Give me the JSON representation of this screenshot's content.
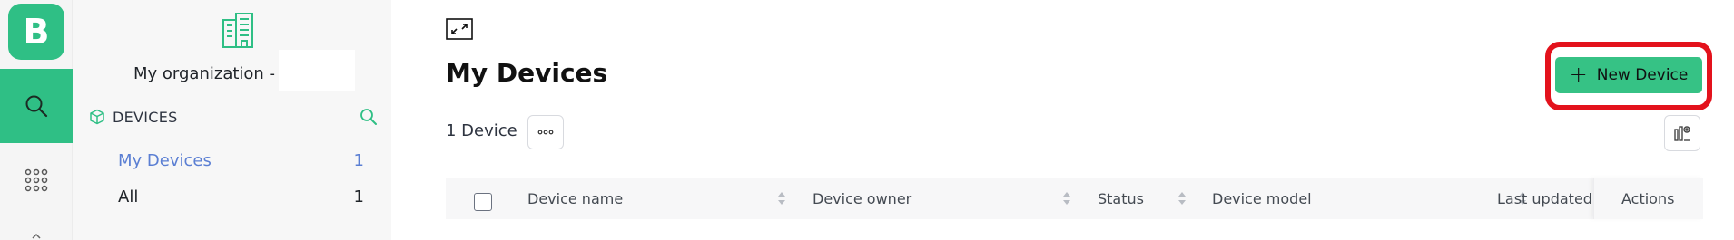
{
  "rail": {
    "logo_letter": "B",
    "icons": [
      "search-icon",
      "apps-grid-icon",
      "chevron-icon"
    ],
    "accent_color": "#2fbf85"
  },
  "sidebar": {
    "org_icon": "building-icon",
    "org_name": "My organization -",
    "section": {
      "icon": "cube-icon",
      "label": "DEVICES",
      "search_icon": "search-icon"
    },
    "items": [
      {
        "label": "My Devices",
        "count": "1",
        "active": true
      },
      {
        "label": "All",
        "count": "1",
        "active": false
      }
    ],
    "active_color": "#5b7fd3"
  },
  "main": {
    "expand_icon": "expand-icon",
    "title": "My Devices",
    "device_count": "1 Device",
    "more_icon": "more-horizontal-icon",
    "new_button": {
      "plus": "+",
      "label": "New Device",
      "color": "#36c285"
    },
    "highlight_color": "#e3121c",
    "settings_icon": "column-settings-icon",
    "table": {
      "columns": [
        {
          "label": "Device name",
          "sortable": true
        },
        {
          "label": "Device owner",
          "sortable": true
        },
        {
          "label": "Status",
          "sortable": true
        },
        {
          "label": "Device model",
          "sortable": true
        },
        {
          "label": "Last updated",
          "sortable": false
        },
        {
          "label": "Actions",
          "sortable": false
        }
      ]
    }
  }
}
